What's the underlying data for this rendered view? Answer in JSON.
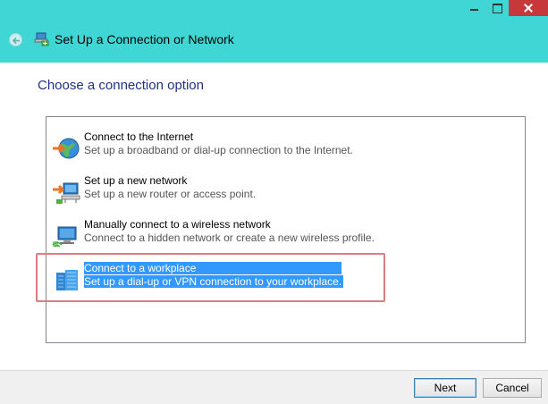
{
  "window": {
    "title": "Set Up a Connection or Network"
  },
  "main": {
    "heading": "Choose a connection option",
    "options": [
      {
        "title": "Connect to the Internet",
        "description": "Set up a broadband or dial-up connection to the Internet.",
        "icon": "globe-network-icon"
      },
      {
        "title": "Set up a new network",
        "description": "Set up a new router or access point.",
        "icon": "router-setup-icon"
      },
      {
        "title": "Manually connect to a wireless network",
        "description": "Connect to a hidden network or create a new wireless profile.",
        "icon": "wireless-network-icon"
      },
      {
        "title": "Connect to a workplace",
        "description": "Set up a dial-up or VPN connection to your workplace.",
        "icon": "workplace-icon",
        "selected": true
      }
    ]
  },
  "footer": {
    "next_label": "Next",
    "cancel_label": "Cancel"
  },
  "colors": {
    "titlebar": "#40d6d6",
    "heading": "#1e3287",
    "selection": "#3399ff",
    "close_button": "#c7383a",
    "highlight_outline": "#e07a85"
  }
}
